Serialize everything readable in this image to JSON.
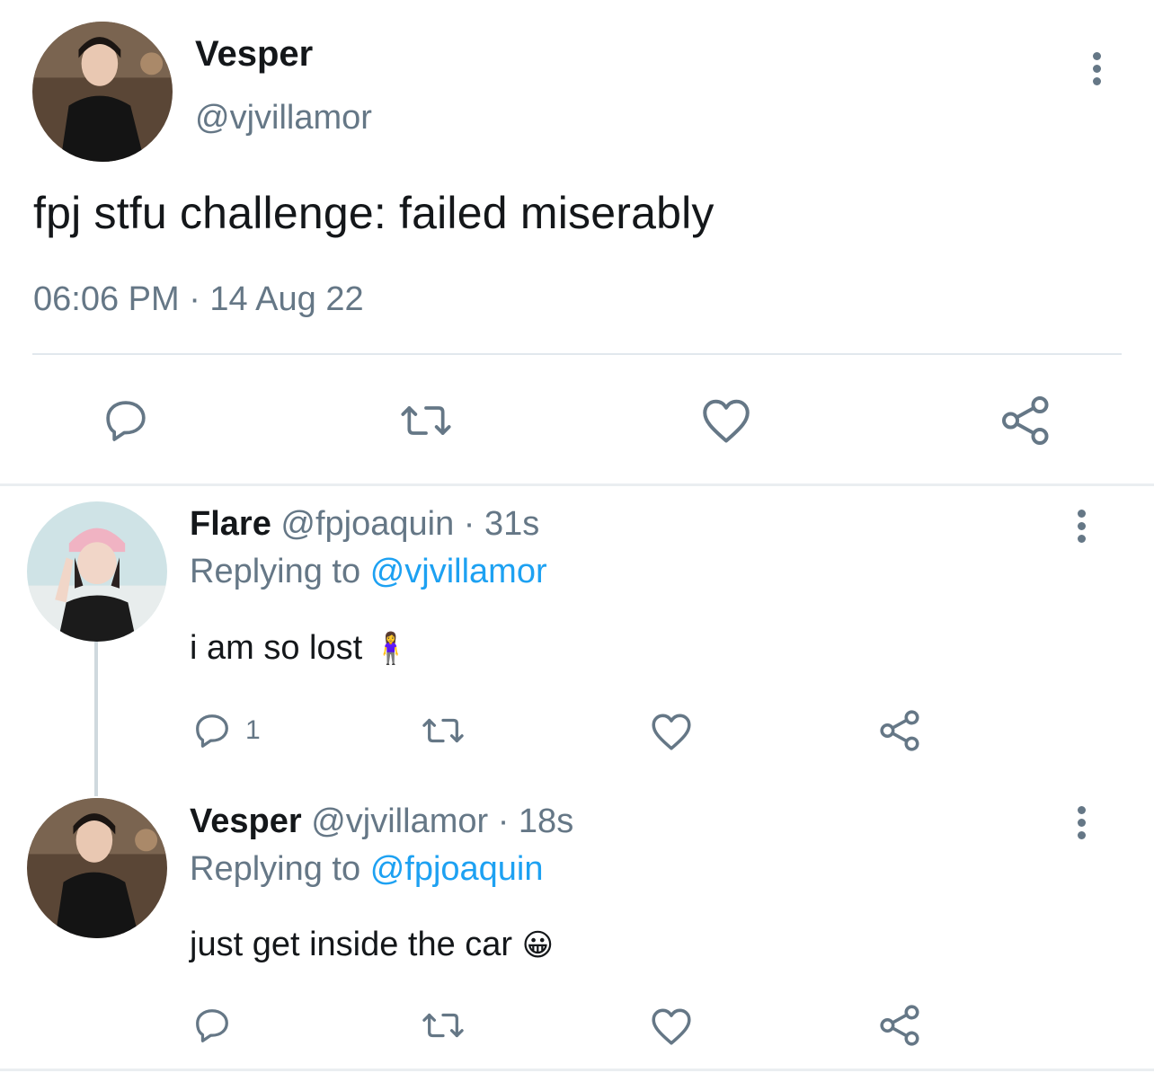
{
  "main_tweet": {
    "name": "Vesper",
    "handle": "@vjvillamor",
    "text": "fpj stfu challenge: failed miserably",
    "timestamp": "06:06 PM · 14 Aug 22",
    "actions": [
      "reply-icon",
      "retweet-icon",
      "like-icon",
      "share-icon"
    ]
  },
  "replies": [
    {
      "name": "Flare",
      "handle": "@fpjoaquin",
      "separator": "·",
      "time": "31s",
      "replying_prefix": "Replying to",
      "replying_to": "@vjvillamor",
      "text": "i am so lost",
      "emoji": "🧍‍♀️",
      "reply_count": "1"
    },
    {
      "name": "Vesper",
      "handle": "@vjvillamor",
      "separator": "·",
      "time": "18s",
      "replying_prefix": "Replying to",
      "replying_to": "@fpjoaquin",
      "text": "just get inside the car",
      "emoji": "😀",
      "reply_count": ""
    }
  ],
  "colors": {
    "text": "#14171a",
    "muted": "#657786",
    "link": "#1da1f2",
    "divider": "#e1e8ed"
  }
}
